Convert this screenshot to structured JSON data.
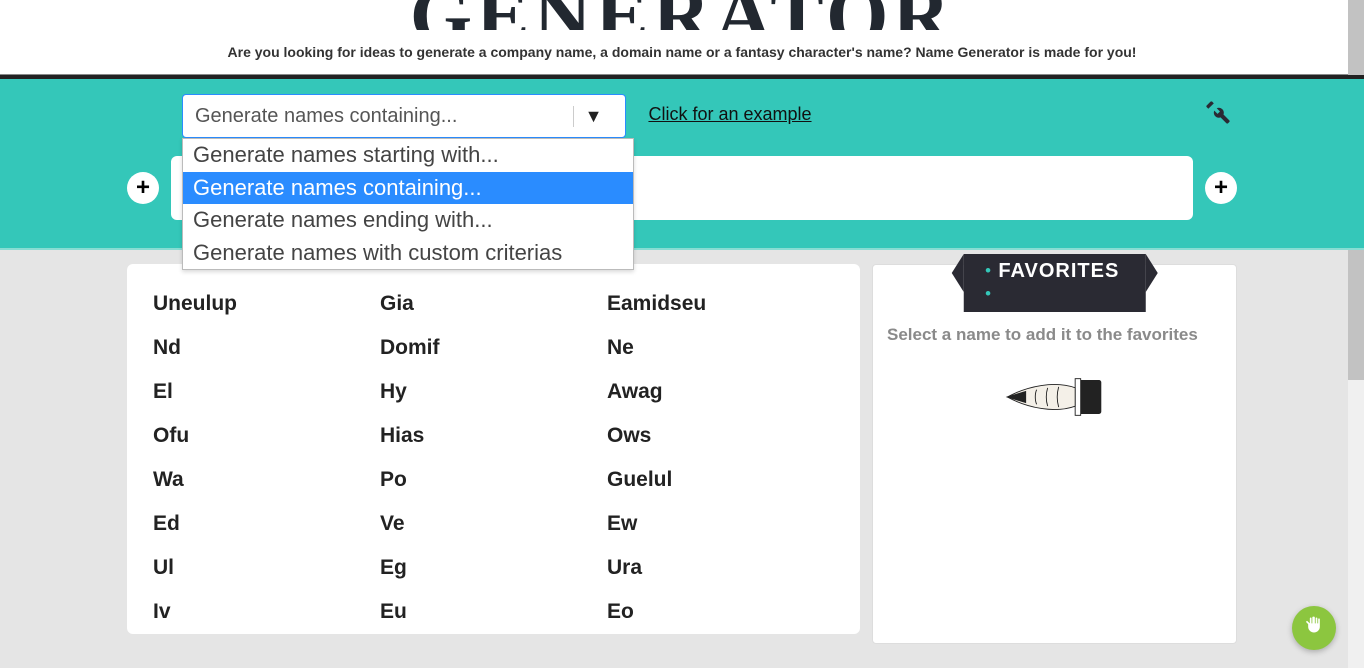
{
  "header": {
    "logo": "GENERATOR",
    "tagline": "Are you looking for ideas to generate a company name, a domain name or a fantasy character's name? Name Generator is made for you!"
  },
  "search": {
    "selected": "Generate names containing...",
    "options": [
      "Generate names starting with...",
      "Generate names containing...",
      "Generate names ending with...",
      "Generate names with custom criterias"
    ],
    "selected_index": 1,
    "example_link": "Click for an example",
    "input_value": ""
  },
  "results": {
    "col1": [
      "Uneulup",
      "Nd",
      "El",
      "Ofu",
      "Wa",
      "Ed",
      "Ul",
      "Iv"
    ],
    "col2": [
      "Gia",
      "Domif",
      "Hy",
      "Hias",
      "Po",
      "Ve",
      "Eg",
      "Eu"
    ],
    "col3": [
      "Eamidseu",
      "Ne",
      "Awag",
      "Ows",
      "Guelul",
      "Ew",
      "Ura",
      "Eo"
    ]
  },
  "favorites": {
    "title": "FAVORITES",
    "hint": "Select a name to add it to the favorites"
  }
}
